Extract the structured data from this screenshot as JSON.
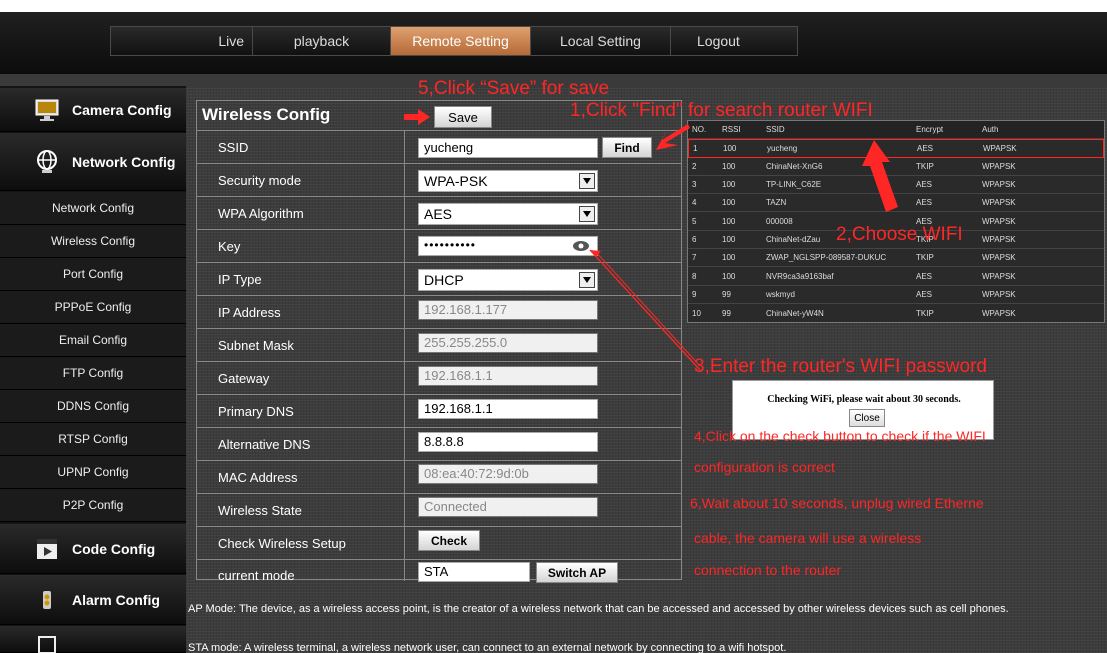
{
  "nav": {
    "tabs": [
      {
        "label": "Live"
      },
      {
        "label": "playback"
      },
      {
        "label": "Remote Setting",
        "active": true
      },
      {
        "label": "Local Setting"
      },
      {
        "label": "Logout"
      }
    ]
  },
  "sidebar": {
    "camera_config": "Camera Config",
    "network_config": "Network Config",
    "sub_items": [
      "Network Config",
      "Wireless Config",
      "Port Config",
      "PPPoE Config",
      "Email Config",
      "FTP Config",
      "DDNS Config",
      "RTSP Config",
      "UPNP Config",
      "P2P Config"
    ],
    "code_config": "Code Config",
    "alarm_config": "Alarm Config"
  },
  "panel": {
    "title": "Wireless Config",
    "save_label": "Save",
    "find_label": "Find",
    "check_label": "Check",
    "switch_ap_label": "Switch AP",
    "rows": {
      "ssid": {
        "label": "SSID",
        "value": "yucheng"
      },
      "security_mode": {
        "label": "Security mode",
        "value": "WPA-PSK"
      },
      "wpa_algorithm": {
        "label": "WPA Algorithm",
        "value": "AES"
      },
      "key": {
        "label": "Key",
        "value": "••••••••••"
      },
      "ip_type": {
        "label": "IP Type",
        "value": "DHCP"
      },
      "ip_address": {
        "label": "IP Address",
        "value": "192.168.1.177"
      },
      "subnet_mask": {
        "label": "Subnet Mask",
        "value": "255.255.255.0"
      },
      "gateway": {
        "label": "Gateway",
        "value": "192.168.1.1"
      },
      "primary_dns": {
        "label": "Primary DNS",
        "value": "192.168.1.1"
      },
      "alternative_dns": {
        "label": "Alternative DNS",
        "value": "8.8.8.8"
      },
      "mac_address": {
        "label": "MAC Address",
        "value": "08:ea:40:72:9d:0b"
      },
      "wireless_state": {
        "label": "Wireless State",
        "value": "Connected"
      },
      "check_setup": {
        "label": "Check Wireless Setup"
      },
      "current_mode": {
        "label": "current mode",
        "value": "STA"
      }
    }
  },
  "wifi_table": {
    "headers": [
      "NO.",
      "RSSI",
      "SSID",
      "Encrypt",
      "Auth"
    ],
    "rows": [
      [
        "1",
        "100",
        "yucheng",
        "AES",
        "WPAPSK"
      ],
      [
        "2",
        "100",
        "ChinaNet-XnG6",
        "TKIP",
        "WPAPSK"
      ],
      [
        "3",
        "100",
        "TP-LINK_C62E",
        "AES",
        "WPAPSK"
      ],
      [
        "4",
        "100",
        "TAZN",
        "AES",
        "WPAPSK"
      ],
      [
        "5",
        "100",
        "000008",
        "AES",
        "WPAPSK"
      ],
      [
        "6",
        "100",
        "ChinaNet-dZau",
        "TKIP",
        "WPAPSK"
      ],
      [
        "7",
        "100",
        "ZWAP_NGLSPP-089587-DUKUC",
        "TKIP",
        "WPAPSK"
      ],
      [
        "8",
        "100",
        "NVR9ca3a9163baf",
        "AES",
        "WPAPSK"
      ],
      [
        "9",
        "99",
        "wskmyd",
        "AES",
        "WPAPSK"
      ],
      [
        "10",
        "99",
        "ChinaNet-yW4N",
        "TKIP",
        "WPAPSK"
      ]
    ]
  },
  "dialog": {
    "message": "Checking WiFi, please wait about 30 seconds.",
    "close_label": "Close"
  },
  "annotations": {
    "step1": "1,Click \"Find\" for search router WIFI",
    "step2": "2,Choose WIFI",
    "step3": "3,Enter the router's WIFI password",
    "step4a": "4,Click on the check button to check if the WIFI",
    "step4b": "configuration is correct",
    "step5": "5,Click “Save” for save",
    "step6a": "6,Wait about 10 seconds, unplug wired Etherne",
    "step6b": "cable, the camera will use a wireless",
    "step6c": "connection to the router"
  },
  "descriptions": {
    "ap_mode": "AP Mode: The device, as a wireless access point, is the creator of a wireless network that can be accessed and accessed by other wireless devices such as cell phones.",
    "sta_mode": "STA mode: A wireless terminal, a wireless network user, can connect to an external network by connecting to a wifi hotspot."
  },
  "colors": {
    "annotation": "#ff2626",
    "active_tab": "#c87a45"
  }
}
